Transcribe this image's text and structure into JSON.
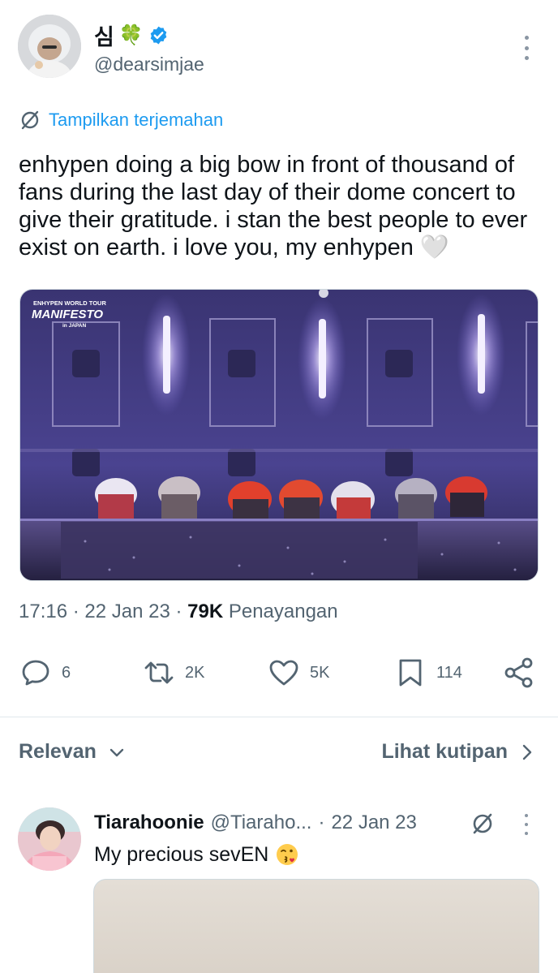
{
  "author": {
    "name": "심",
    "name_emoji": "🍀",
    "handle": "@dearsimjae",
    "verified": true
  },
  "translate": {
    "label": "Tampilkan terjemahan"
  },
  "tweet": {
    "text": "enhypen doing a big bow in front of thousand of fans during the last day of their dome concert to give their gratitude. i stan the best people to ever exist on earth. i love you, my enhypen 🤍"
  },
  "media": {
    "overlay_line1": "ENHYPEN WORLD TOUR",
    "overlay_line2": "MANIFESTO",
    "overlay_line3": "in JAPAN"
  },
  "meta": {
    "time": "17:16",
    "sep1": " · ",
    "date": "22 Jan 23",
    "sep2": " · ",
    "views_count": "79K",
    "views_label": " Penayangan"
  },
  "actions": {
    "replies": "6",
    "retweets": "2K",
    "likes": "5K",
    "bookmarks": "114"
  },
  "replies_header": {
    "sort_label": "Relevan",
    "quotes_label": "Lihat kutipan"
  },
  "reply": {
    "name": "Tiarahoonie",
    "handle": "@Tiaraho...",
    "sep": "·",
    "date": "22 Jan 23",
    "text": "My precious sevEN"
  },
  "icons": {
    "verified": "verified-badge-icon",
    "translate": "translate-icon",
    "reply": "reply-icon",
    "retweet": "retweet-icon",
    "like": "heart-icon",
    "bookmark": "bookmark-icon",
    "share": "share-icon",
    "more": "more-icon",
    "chevron_down": "chevron-down-icon",
    "chevron_right": "chevron-right-icon"
  },
  "colors": {
    "link": "#1d9bf0",
    "secondary": "#536471",
    "primary_text": "#0f1419",
    "verified": "#1d9bf0"
  }
}
